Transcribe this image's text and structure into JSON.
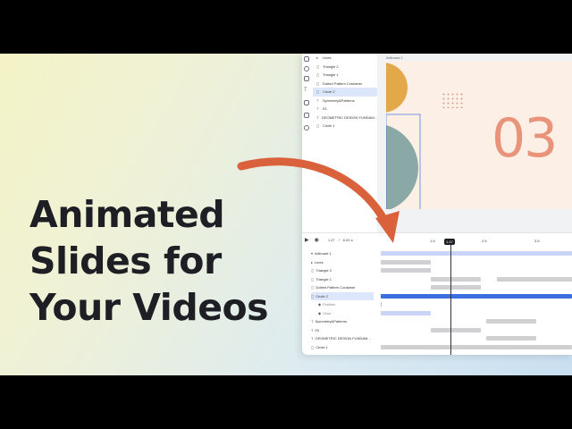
{
  "headline": {
    "line1": "Animated",
    "line2": "Slides for",
    "line3": "Your Videos"
  },
  "layers_panel": {
    "items": [
      {
        "label": "Lines",
        "icon": "group-icon",
        "selected": false
      },
      {
        "label": "Triangle 2",
        "icon": "shape-icon",
        "selected": false
      },
      {
        "label": "Triangle 1",
        "icon": "shape-icon",
        "selected": false
      },
      {
        "label": "Dotted Pattern Container",
        "icon": "shape-icon",
        "selected": false
      },
      {
        "label": "Circle 2",
        "icon": "shape-icon",
        "selected": true
      },
      {
        "label": "Symmetry&Patterns",
        "icon": "text-icon",
        "selected": false
      },
      {
        "label": "03",
        "icon": "text-icon",
        "selected": false
      },
      {
        "label": "GEOMETRIC DESIGN FUNDAM...",
        "icon": "text-icon",
        "selected": false
      },
      {
        "label": "Circle 1",
        "icon": "shape-icon",
        "selected": false
      }
    ]
  },
  "canvas": {
    "artboard_label": "Artboard 1",
    "big_number": "03"
  },
  "timeline": {
    "current_time": "1.47",
    "duration": "6.00 s",
    "ruler": [
      "1.5",
      "2.5",
      "3.5"
    ],
    "playhead_label": "1.47",
    "rows": [
      {
        "label": "Artboard 1",
        "icon": "board-icon",
        "child": false,
        "selected": false
      },
      {
        "label": "Lines",
        "icon": "group-icon",
        "child": false,
        "selected": false
      },
      {
        "label": "Triangle 2",
        "icon": "shape-icon",
        "child": false,
        "selected": false
      },
      {
        "label": "Triangle 1",
        "icon": "shape-icon",
        "child": false,
        "selected": false
      },
      {
        "label": "Dotted Pattern Container",
        "icon": "shape-icon",
        "child": false,
        "selected": false
      },
      {
        "label": "Circle 2",
        "icon": "shape-icon",
        "child": false,
        "selected": true
      },
      {
        "label": "Position",
        "icon": "diamond-icon",
        "child": true,
        "selected": false
      },
      {
        "label": "Glow",
        "icon": "diamond-icon",
        "child": true,
        "selected": false
      },
      {
        "label": "Symmetry&Patterns",
        "icon": "text-icon",
        "child": false,
        "selected": false
      },
      {
        "label": "03",
        "icon": "text-icon",
        "child": false,
        "selected": false
      },
      {
        "label": "GEOMETRIC DESIGN FUNDAM...",
        "icon": "text-icon",
        "child": false,
        "selected": false
      },
      {
        "label": "Circle 1",
        "icon": "shape-icon",
        "child": false,
        "selected": false
      }
    ]
  },
  "colors": {
    "accent_arrow": "#d9613c",
    "selection": "#3b6fe0",
    "circle_top": "#e3a84a",
    "circle_bottom": "#8aa9a6"
  }
}
